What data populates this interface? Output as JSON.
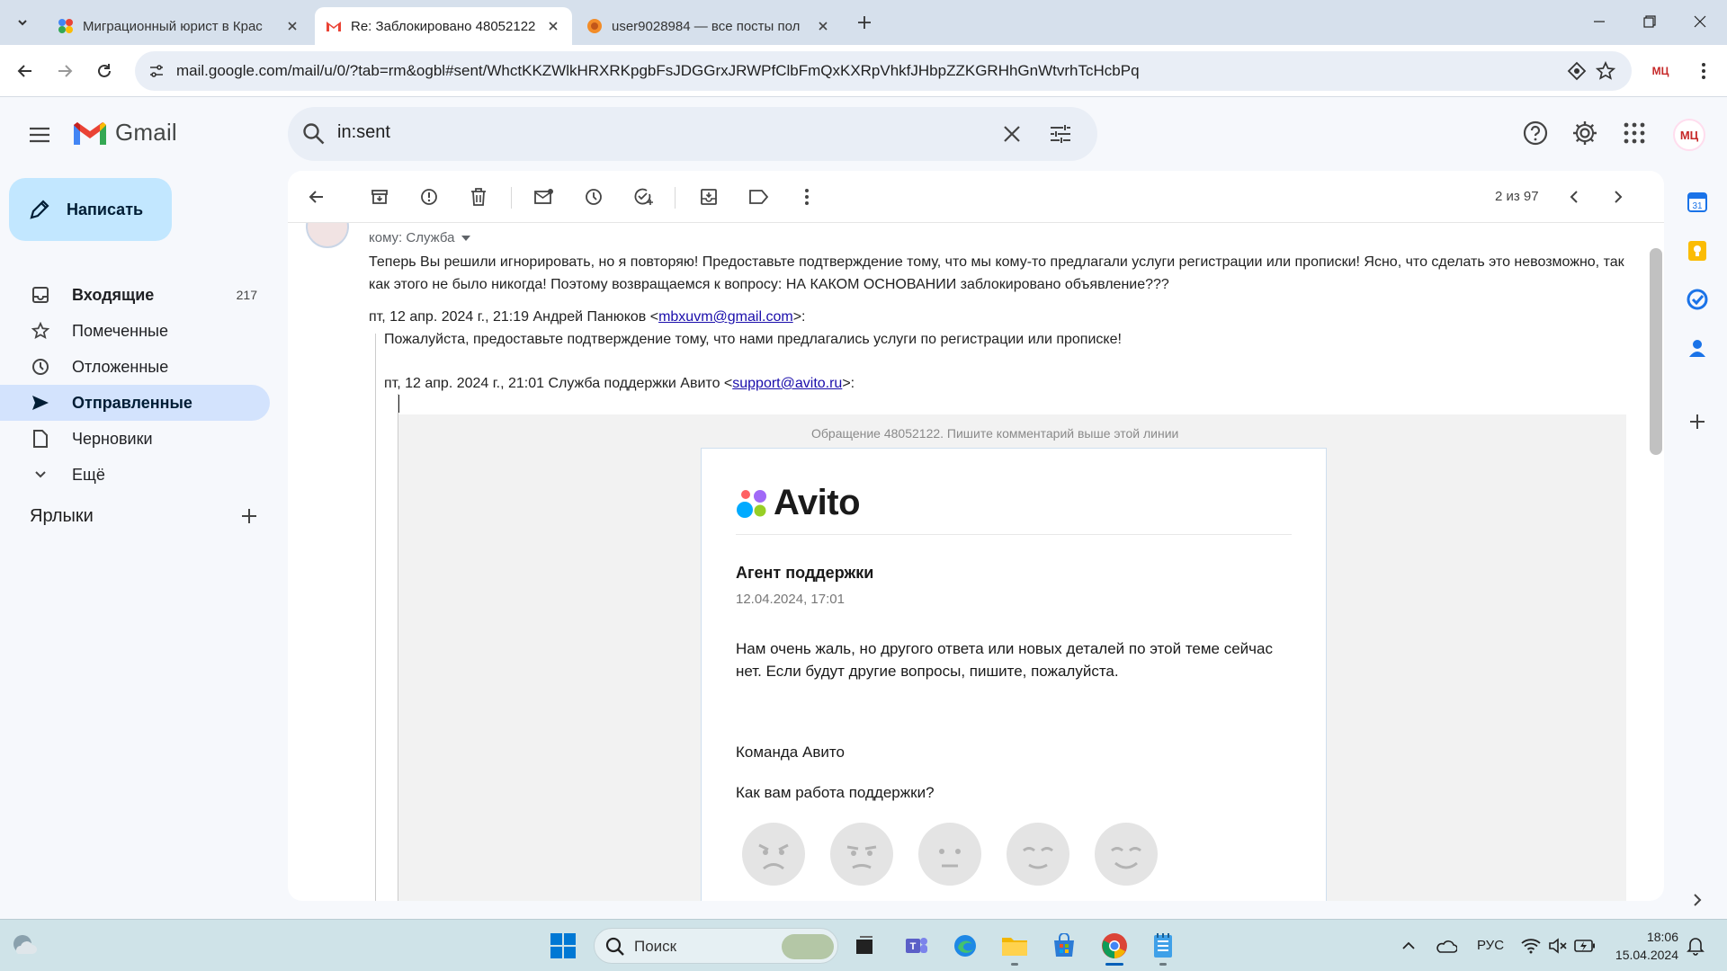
{
  "browser": {
    "tabs": [
      {
        "title": "Миграционный юрист в Крас"
      },
      {
        "title": "Re: Заблокировано 48052122 -"
      },
      {
        "title": "user9028984 — все посты пол"
      }
    ],
    "url": "mail.google.com/mail/u/0/?tab=rm&ogbl#sent/WhctKKZWlkHRXRKpgbFsJDGGrxJRWPfClbFmQxKXRpVhkfJHbpZZKGRHhGnWtvrhTcHcbPq",
    "profile_badge": "МЦ"
  },
  "gmail": {
    "logo_text": "Gmail",
    "search_value": "in:sent",
    "account_badge": "МЦ",
    "compose_label": "Написать",
    "nav": [
      {
        "label": "Входящие",
        "count": "217"
      },
      {
        "label": "Помеченные"
      },
      {
        "label": "Отложенные"
      },
      {
        "label": "Отправленные"
      },
      {
        "label": "Черновики"
      },
      {
        "label": "Ещё"
      }
    ],
    "labels_heading": "Ярлыки",
    "pager": "2 из 97"
  },
  "message": {
    "to_line": "кому: Служба",
    "body": "Теперь Вы решили игнорировать, но я повторяю! Предоставьте подтверждение тому, что мы кому-то предлагали услуги регистрации или прописки! Ясно, что сделать это невозможно, так как этого не было никогда! Поэтому возвращаемся к вопросу: НА КАКОМ ОСНОВАНИИ заблокировано объявление???",
    "quote1_prefix": "пт, 12 апр. 2024 г., 21:19 Андрей Панюков <",
    "quote1_email": "mbxuvm@gmail.com",
    "quote1_suffix": ">:",
    "quote1_text": "Пожалуйста, предоставьте подтверждение тому, что нами предлагались услуги по регистрации или прописке!",
    "quote2_prefix": "пт, 12 апр. 2024 г., 21:01 Служба поддержки Авито <",
    "quote2_email": "support@avito.ru",
    "quote2_suffix": ">:",
    "ticket_note": "Обращение 48052122. Пишите комментарий выше этой линии",
    "avito": {
      "logo_word": "Avito",
      "agent": "Агент поддержки",
      "date": "12.04.2024, 17:01",
      "reply": "Нам очень жаль, но другого ответа или новых деталей по этой теме сейчас нет. Если будут другие вопросы, пишите, пожалуйста.",
      "team": "Команда Авито",
      "rating_question": "Как вам работа поддержки?"
    }
  },
  "taskbar": {
    "search_label": "Поиск",
    "language": "РУС",
    "time": "18:06",
    "date": "15.04.2024"
  },
  "colors": {
    "accent": "#0b57d0",
    "compose_bg": "#c2e7ff",
    "active_nav": "#d3e3fd",
    "link": "#1a0dab"
  }
}
